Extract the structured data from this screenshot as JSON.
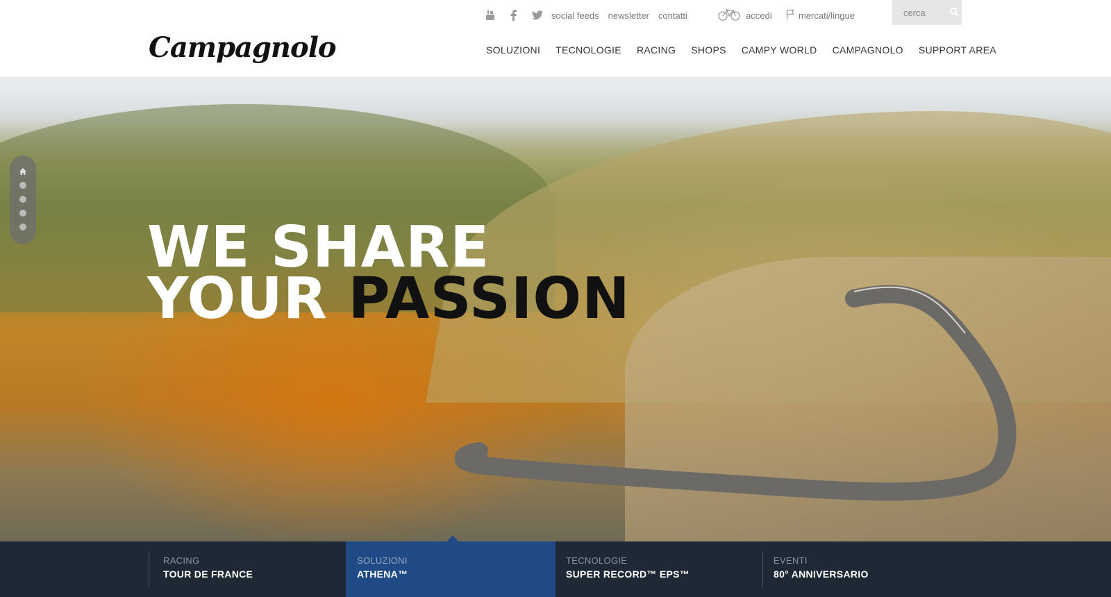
{
  "brand": {
    "logo_text": "Campagnolo"
  },
  "topbar": {
    "social_icons": [
      "youtube-icon",
      "facebook-icon",
      "twitter-icon"
    ],
    "links": [
      "social feeds",
      "newsletter",
      "contatti"
    ],
    "login_label": "accedi",
    "markets_label": "mercati/lingue",
    "search_placeholder": "cerca"
  },
  "nav": {
    "items": [
      "SOLUZIONI",
      "TECNOLOGIE",
      "RACING",
      "SHOPS",
      "CAMPY WORLD",
      "CAMPAGNOLO",
      "SUPPORT AREA"
    ]
  },
  "hero": {
    "line1": "WE SHARE",
    "line2_a": "YOUR",
    "line2_b": "PASSION",
    "slider": {
      "slides": 5,
      "active": 0
    }
  },
  "tiles": [
    {
      "category": "RACING",
      "title": "TOUR DE FRANCE"
    },
    {
      "category": "SOLUZIONI",
      "title": "ATHENA™"
    },
    {
      "category": "TECNOLOGIE",
      "title": "SUPER RECORD™ EPS™"
    },
    {
      "category": "EVENTI",
      "title": "80° ANNIVERSARIO"
    }
  ],
  "colors": {
    "strip": "#1f2835",
    "active_tile": "#1f4a86"
  }
}
